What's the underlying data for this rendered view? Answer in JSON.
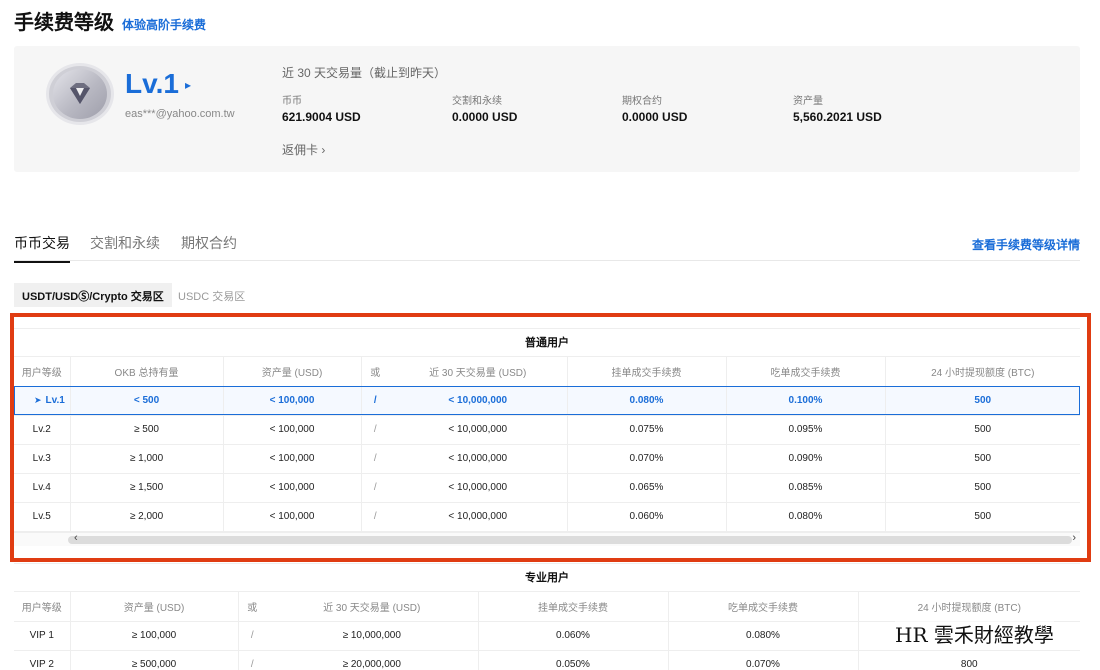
{
  "header": {
    "title": "手续费等级",
    "link": "体验高阶手续费"
  },
  "account": {
    "level": "Lv.1",
    "level_arrow": "▸",
    "email": "eas***@yahoo.com.tw",
    "volume_title": "近 30 天交易量（截止到昨天）",
    "stats": [
      {
        "label": "币币",
        "value": "621.9004 USD"
      },
      {
        "label": "交割和永续",
        "value": "0.0000 USD"
      },
      {
        "label": "期权合约",
        "value": "0.0000 USD"
      },
      {
        "label": "资产量",
        "value": "5,560.2021 USD"
      }
    ],
    "rebate": "返佣卡 ›"
  },
  "tabs": [
    {
      "label": "币币交易",
      "active": true
    },
    {
      "label": "交割和永续",
      "active": false
    },
    {
      "label": "期权合约",
      "active": false
    }
  ],
  "fee_detail_link": "查看手续费等级详情",
  "subtabs": {
    "active": "USDT/USDⓈ/Crypto 交易区",
    "inactive": "USDC 交易区"
  },
  "regular": {
    "title": "普通用户",
    "headers": [
      "用户等级",
      "OKB 总持有量",
      "资产量 (USD)",
      "或",
      "近 30 天交易量 (USD)",
      "挂单成交手续费",
      "吃单成交手续费",
      "24 小时提现额度 (BTC)"
    ],
    "current_marker": "➤",
    "rows": [
      [
        "Lv.1",
        "< 500",
        "< 100,000",
        "/",
        "< 10,000,000",
        "0.080%",
        "0.100%",
        "500"
      ],
      [
        "Lv.2",
        "≥ 500",
        "< 100,000",
        "/",
        "< 10,000,000",
        "0.075%",
        "0.095%",
        "500"
      ],
      [
        "Lv.3",
        "≥ 1,000",
        "< 100,000",
        "/",
        "< 10,000,000",
        "0.070%",
        "0.090%",
        "500"
      ],
      [
        "Lv.4",
        "≥ 1,500",
        "< 100,000",
        "/",
        "< 10,000,000",
        "0.065%",
        "0.085%",
        "500"
      ],
      [
        "Lv.5",
        "≥ 2,000",
        "< 100,000",
        "/",
        "< 10,000,000",
        "0.060%",
        "0.080%",
        "500"
      ]
    ]
  },
  "professional": {
    "title": "专业用户",
    "headers": [
      "用户等级",
      "资产量 (USD)",
      "或",
      "近 30 天交易量 (USD)",
      "挂单成交手续费",
      "吃单成交手续费",
      "24 小时提现额度 (BTC)"
    ],
    "rows": [
      [
        "VIP 1",
        "≥ 100,000",
        "/",
        "≥ 10,000,000",
        "0.060%",
        "0.080%",
        ""
      ],
      [
        "VIP 2",
        "≥ 500,000",
        "/",
        "≥ 20,000,000",
        "0.050%",
        "0.070%",
        "800"
      ]
    ]
  },
  "scroll": {
    "left": "‹",
    "right": "›"
  },
  "watermark": "HR 雲禾財經教學",
  "colors": {
    "accent": "#1a6dd8",
    "highlight": "#e03c12"
  }
}
